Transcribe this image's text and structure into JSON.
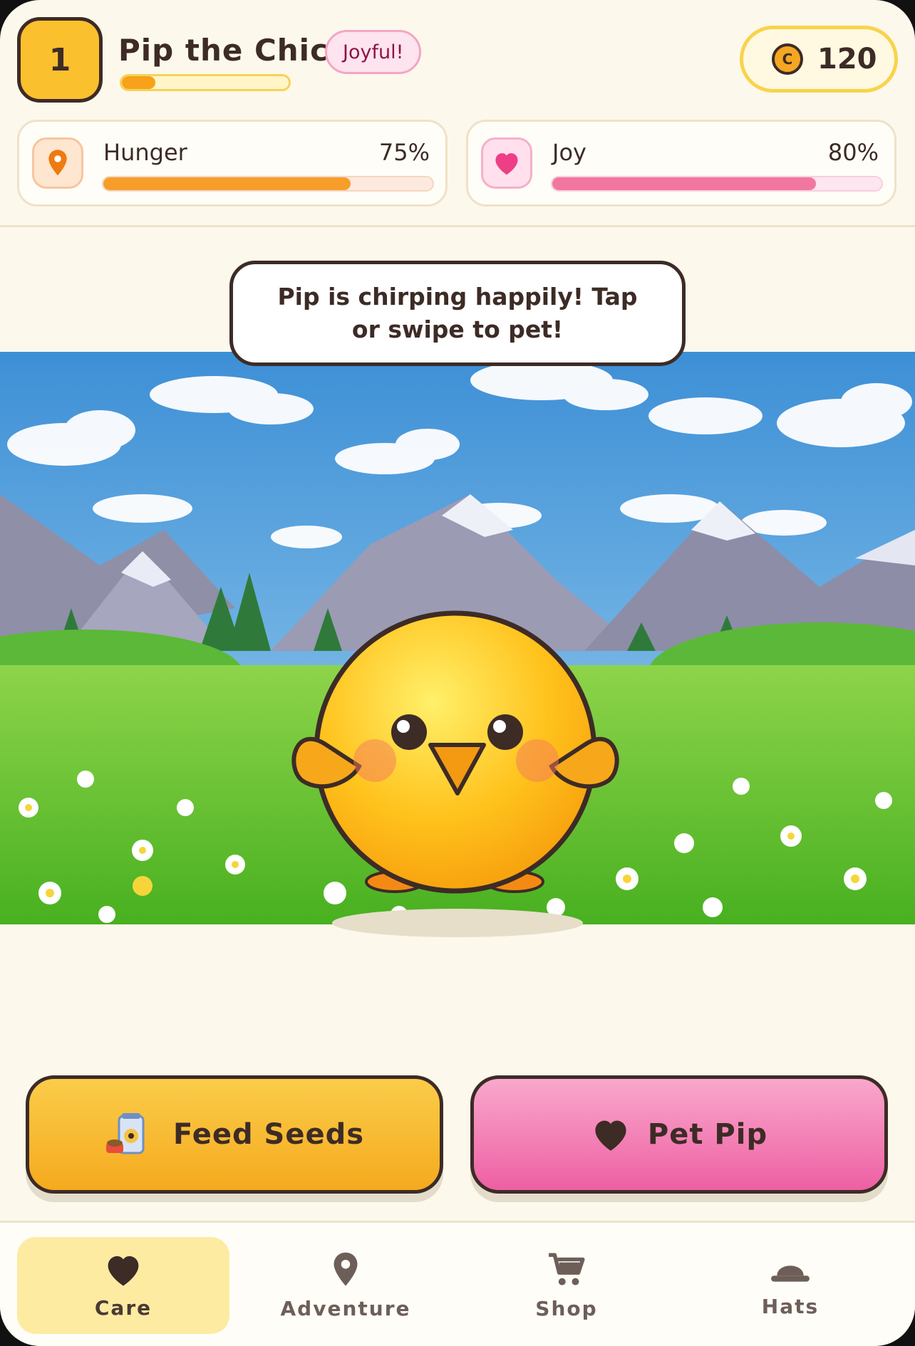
{
  "header": {
    "level": "1",
    "pet_name": "Pip the Chick",
    "mood": "Joyful!",
    "xp_progress": 0.2,
    "coins": "120",
    "coin_symbol": "C"
  },
  "stats": {
    "hunger": {
      "label": "Hunger",
      "value_text": "75%",
      "value": 0.75,
      "icon": "location-pin-icon"
    },
    "joy": {
      "label": "Joy",
      "value_text": "80%",
      "value": 0.8,
      "icon": "heart-icon"
    }
  },
  "scene": {
    "speech": "Pip is chirping happily! Tap or swipe to pet!"
  },
  "actions": {
    "feed_label": "Feed Seeds",
    "pet_label": "Pet Pip"
  },
  "nav": {
    "items": [
      {
        "label": "Care",
        "icon": "heart-icon",
        "active": true
      },
      {
        "label": "Adventure",
        "icon": "location-pin-icon",
        "active": false
      },
      {
        "label": "Shop",
        "icon": "cart-icon",
        "active": false
      },
      {
        "label": "Hats",
        "icon": "hat-icon",
        "active": false
      }
    ]
  },
  "colors": {
    "accent_yellow": "#fbc02d",
    "accent_pink": "#ee5fa3",
    "hunger_bar": "#f79d2a",
    "joy_bar": "#f277a0",
    "outline": "#3d2b26",
    "background": "#fdf8ec"
  }
}
